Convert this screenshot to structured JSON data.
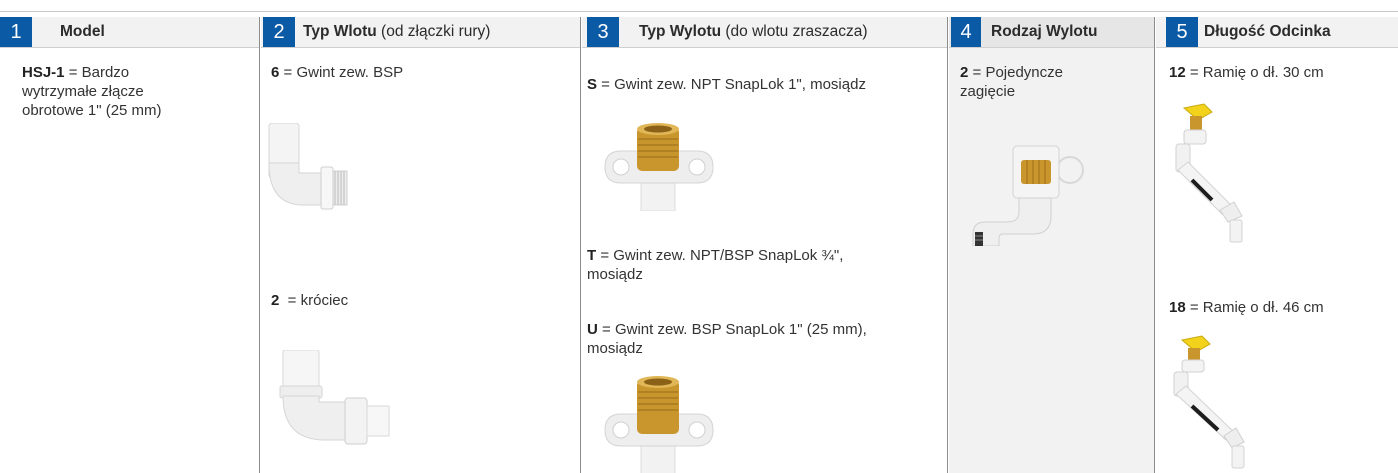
{
  "columns": [
    {
      "number": "1",
      "title": "Model",
      "items": [
        {
          "code": "HSJ-1",
          "text": " = Bardzo",
          "text2": "wytrzymałe złącze",
          "text3": "obrotowe 1\" (25 mm)"
        }
      ]
    },
    {
      "number": "2",
      "title": "Typ Wlotu",
      "subtitle": " (od złączki rury)",
      "items": [
        {
          "code": "6",
          "text": " = Gwint zew. BSP",
          "image": "threaded-elbow-fitting"
        },
        {
          "code": "2",
          "text": "  = króciec",
          "image": "spigot-elbow-fitting"
        }
      ]
    },
    {
      "number": "3",
      "title": "Typ Wylotu",
      "subtitle": " (do wlotu zraszacza)",
      "items": [
        {
          "code": "S",
          "text": " = Gwint zew. NPT SnapLok 1\", mosiądz",
          "image": "brass-outlet-s"
        },
        {
          "code": "T",
          "text": " = Gwint zew. NPT/BSP SnapLok ¾\",",
          "text2": "mosiądz"
        },
        {
          "code": "U",
          "text": " = Gwint zew. BSP SnapLok 1\" (25 mm),",
          "text2": "mosiądz",
          "image": "brass-outlet-u"
        }
      ]
    },
    {
      "number": "4",
      "title": "Rodzaj Wylotu",
      "items": [
        {
          "code": "2",
          "text": " = Pojedyncze",
          "text2": "zagięcie",
          "image": "single-bend-outlet"
        }
      ]
    },
    {
      "number": "5",
      "title": "Długość Odcinka",
      "items": [
        {
          "code": "12",
          "text": " = Ramię o dł. 30 cm",
          "image": "swing-arm-12"
        },
        {
          "code": "18",
          "text": " = Ramię o dł. 46 cm",
          "image": "swing-arm-18"
        }
      ]
    }
  ],
  "colors": {
    "number_badge": "#0b5aa6",
    "header_bg": "#f2f2f2",
    "brass": "#c9962e",
    "valve_cap": "#f2d21a"
  }
}
